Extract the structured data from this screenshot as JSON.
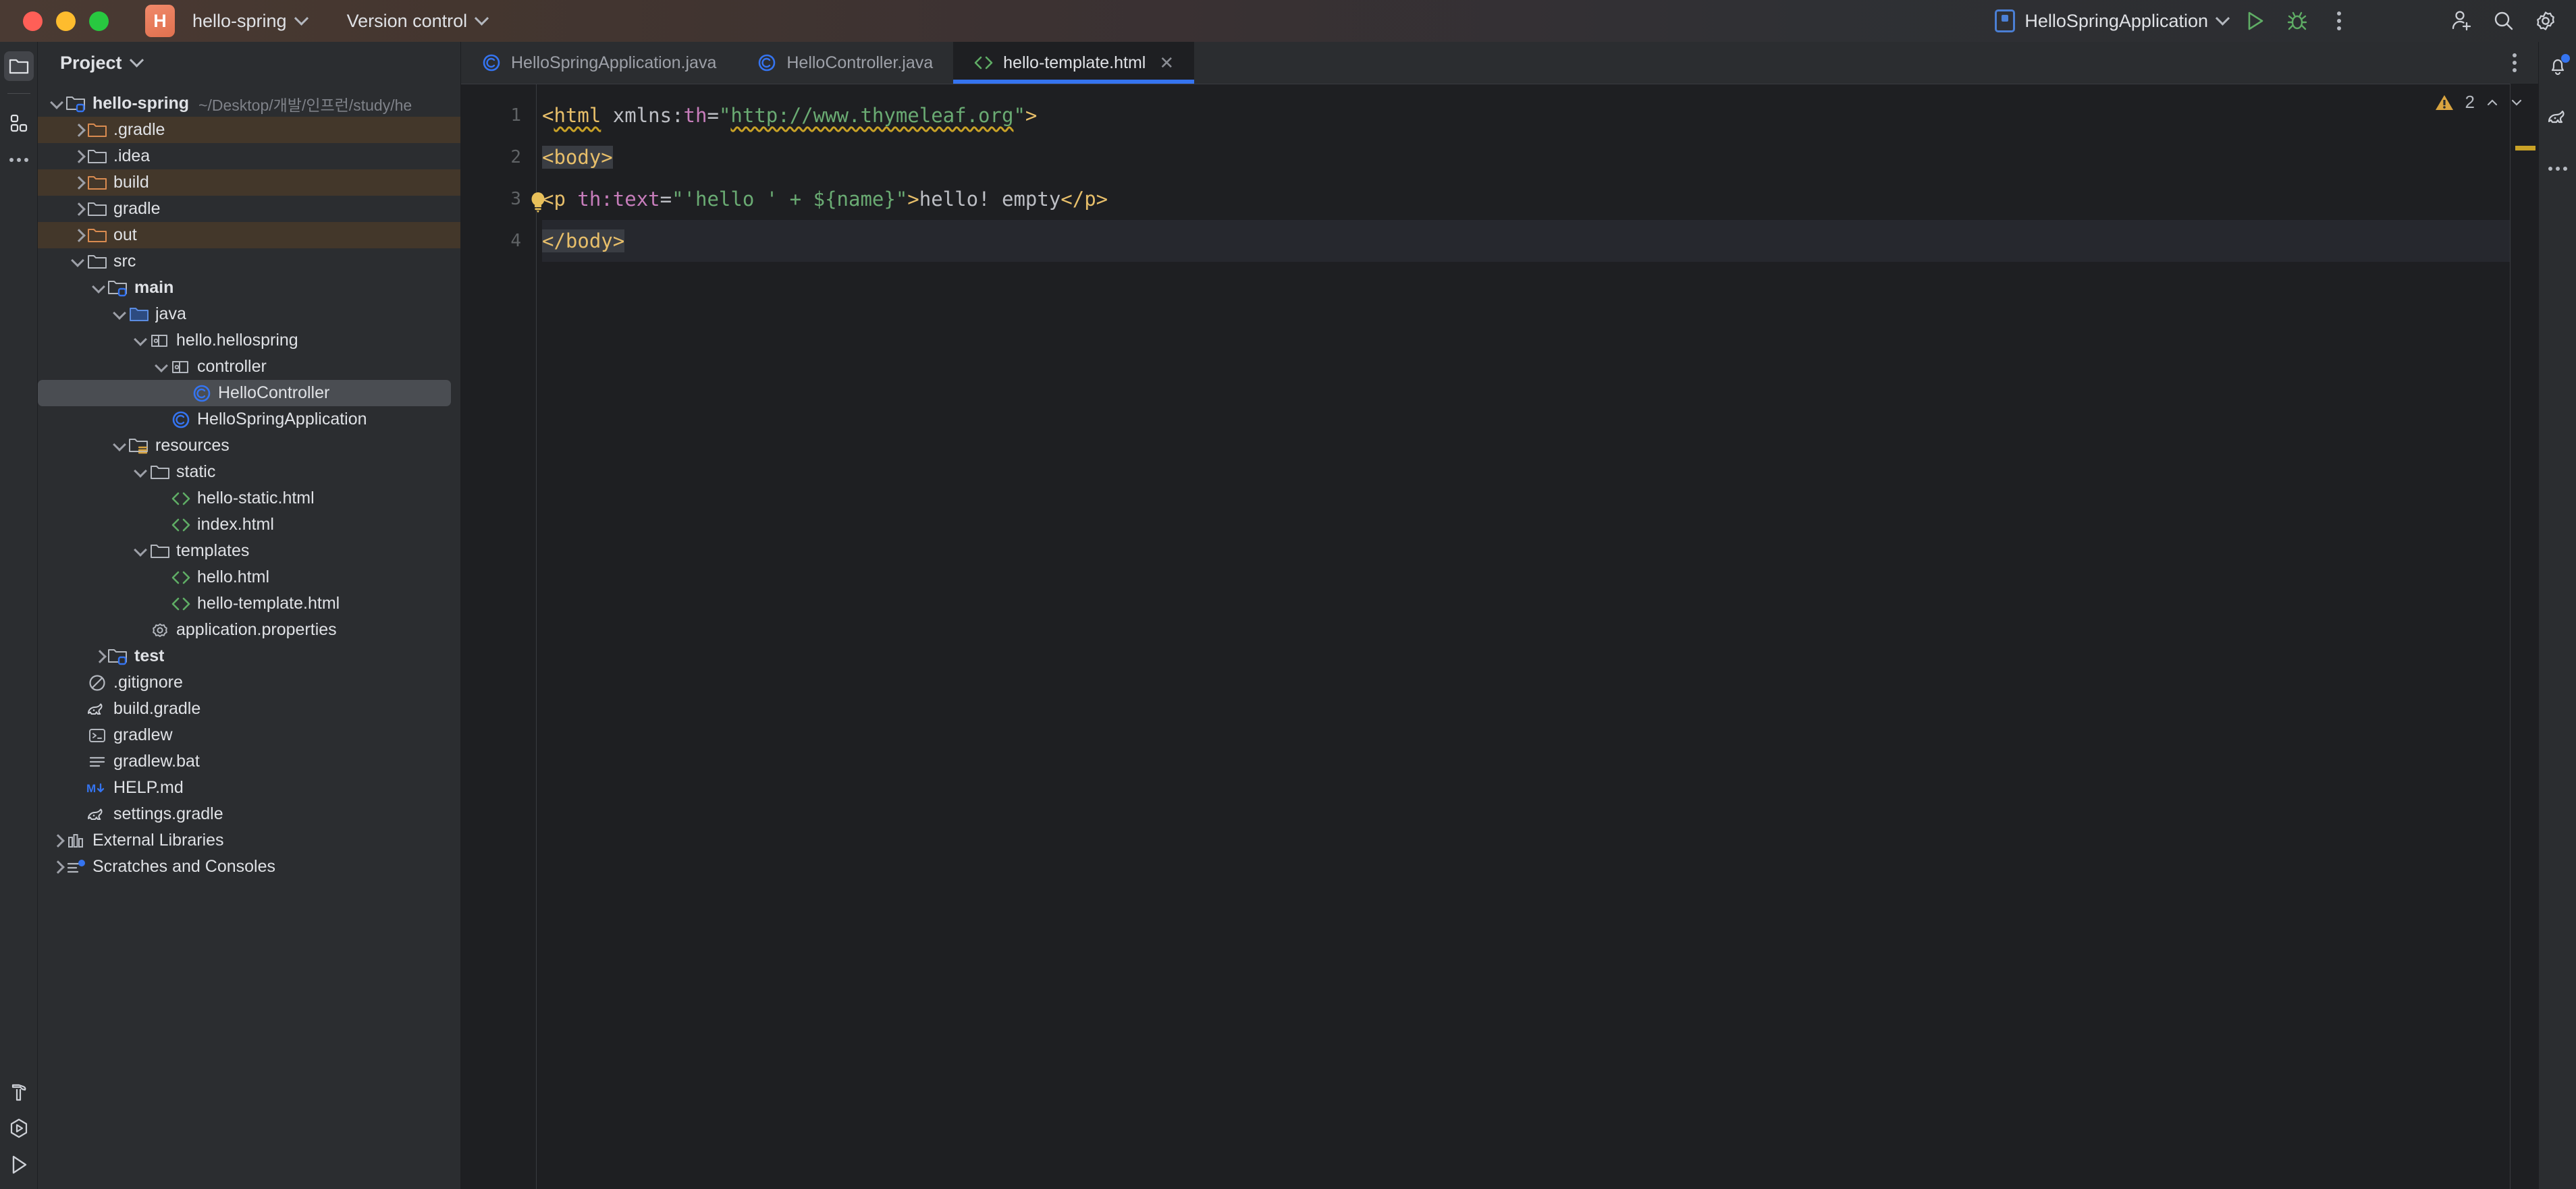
{
  "titlebar": {
    "project_badge": "H",
    "project_name": "hello-spring",
    "version_control": "Version control",
    "run_config": "HelloSpringApplication",
    "icons": {
      "run": "run-icon",
      "debug": "debug-icon",
      "more": "more-vertical-icon",
      "add_user": "add-user-icon",
      "search": "search-icon",
      "settings": "gear-icon"
    }
  },
  "left_rail": {
    "items": [
      {
        "name": "project-tool-window-icon",
        "active": true
      },
      {
        "name": "commit-tool-window-icon",
        "active": false
      },
      {
        "name": "more-tool-windows-icon",
        "active": false
      }
    ],
    "bottom_items": [
      {
        "name": "build-hammer-icon"
      },
      {
        "name": "services-icon"
      },
      {
        "name": "run-icon"
      }
    ]
  },
  "right_rail": {
    "items": [
      {
        "name": "notifications-bell-icon",
        "badge": true
      },
      {
        "name": "gradle-elephant-icon",
        "badge": false
      },
      {
        "name": "more-tool-windows-icon",
        "badge": false
      }
    ]
  },
  "project_panel": {
    "title": "Project",
    "tree": [
      {
        "depth": 0,
        "arrow": "open",
        "icon": "module-folder-icon",
        "label": "hello-spring",
        "bold": true,
        "path": "~/Desktop/개발/인프런/study/he",
        "state": "normal"
      },
      {
        "depth": 1,
        "arrow": "closed",
        "icon": "excluded-folder-icon",
        "label": ".gradle",
        "state": "excluded"
      },
      {
        "depth": 1,
        "arrow": "closed",
        "icon": "folder-icon",
        "label": ".idea",
        "state": "normal"
      },
      {
        "depth": 1,
        "arrow": "closed",
        "icon": "excluded-folder-icon",
        "label": "build",
        "state": "excluded"
      },
      {
        "depth": 1,
        "arrow": "closed",
        "icon": "folder-icon",
        "label": "gradle",
        "state": "normal"
      },
      {
        "depth": 1,
        "arrow": "closed",
        "icon": "excluded-folder-icon",
        "label": "out",
        "state": "excluded"
      },
      {
        "depth": 1,
        "arrow": "open",
        "icon": "folder-icon",
        "label": "src",
        "state": "normal"
      },
      {
        "depth": 2,
        "arrow": "open",
        "icon": "module-folder-icon",
        "label": "main",
        "bold": true,
        "state": "normal"
      },
      {
        "depth": 3,
        "arrow": "open",
        "icon": "source-folder-icon",
        "label": "java",
        "state": "normal"
      },
      {
        "depth": 4,
        "arrow": "open",
        "icon": "package-icon",
        "label": "hello.hellospring",
        "state": "normal"
      },
      {
        "depth": 5,
        "arrow": "open",
        "icon": "package-icon",
        "label": "controller",
        "state": "normal"
      },
      {
        "depth": 6,
        "arrow": "none",
        "icon": "java-class-icon",
        "label": "HelloController",
        "state": "selected"
      },
      {
        "depth": 5,
        "arrow": "none",
        "icon": "java-class-icon",
        "label": "HelloSpringApplication",
        "state": "normal"
      },
      {
        "depth": 3,
        "arrow": "open",
        "icon": "resources-folder-icon",
        "label": "resources",
        "state": "normal"
      },
      {
        "depth": 4,
        "arrow": "open",
        "icon": "folder-icon",
        "label": "static",
        "state": "normal"
      },
      {
        "depth": 5,
        "arrow": "none",
        "icon": "html-file-icon",
        "label": "hello-static.html",
        "state": "normal"
      },
      {
        "depth": 5,
        "arrow": "none",
        "icon": "html-file-icon",
        "label": "index.html",
        "state": "normal"
      },
      {
        "depth": 4,
        "arrow": "open",
        "icon": "folder-icon",
        "label": "templates",
        "state": "normal"
      },
      {
        "depth": 5,
        "arrow": "none",
        "icon": "html-file-icon",
        "label": "hello.html",
        "state": "normal"
      },
      {
        "depth": 5,
        "arrow": "none",
        "icon": "html-file-icon",
        "label": "hello-template.html",
        "state": "normal"
      },
      {
        "depth": 4,
        "arrow": "none",
        "icon": "properties-file-icon",
        "label": "application.properties",
        "state": "normal"
      },
      {
        "depth": 2,
        "arrow": "closed",
        "icon": "module-folder-icon",
        "label": "test",
        "bold": true,
        "state": "normal"
      },
      {
        "depth": 1,
        "arrow": "none",
        "icon": "gitignore-file-icon",
        "label": ".gitignore",
        "state": "normal"
      },
      {
        "depth": 1,
        "arrow": "none",
        "icon": "gradle-file-icon",
        "label": "build.gradle",
        "state": "normal"
      },
      {
        "depth": 1,
        "arrow": "none",
        "icon": "shell-script-icon",
        "label": "gradlew",
        "state": "normal"
      },
      {
        "depth": 1,
        "arrow": "none",
        "icon": "text-file-icon",
        "label": "gradlew.bat",
        "state": "normal"
      },
      {
        "depth": 1,
        "arrow": "none",
        "icon": "markdown-file-icon",
        "label": "HELP.md",
        "state": "normal"
      },
      {
        "depth": 1,
        "arrow": "none",
        "icon": "gradle-file-icon",
        "label": "settings.gradle",
        "state": "normal"
      },
      {
        "depth": 0,
        "arrow": "closed",
        "icon": "external-libraries-icon",
        "label": "External Libraries",
        "state": "normal"
      },
      {
        "depth": 0,
        "arrow": "closed",
        "icon": "scratches-icon",
        "label": "Scratches and Consoles",
        "state": "normal"
      }
    ]
  },
  "editor": {
    "tabs": [
      {
        "label": "HelloSpringApplication.java",
        "icon": "java-class-icon",
        "active": false,
        "closable": false
      },
      {
        "label": "HelloController.java",
        "icon": "java-class-icon",
        "active": false,
        "closable": false
      },
      {
        "label": "hello-template.html",
        "icon": "html-file-icon",
        "active": true,
        "closable": true
      }
    ],
    "tab_close_glyph": "✕",
    "more_tabs_icon": "more-vertical-icon",
    "line_numbers": [
      "1",
      "2",
      "3",
      "4"
    ],
    "caret_line": 4,
    "inspection": {
      "warning_icon": "warning-triangle-icon",
      "warning_count": "2",
      "prev_icon": "chevron-up-icon",
      "next_icon": "chevron-down-icon"
    },
    "gutter_intention_icon": "lightbulb-icon",
    "code_lines": [
      {
        "n": 1,
        "tokens": [
          {
            "t": "<",
            "c": "tag"
          },
          {
            "t": "html",
            "c": "tag squig"
          },
          {
            "t": " ",
            "c": "txt"
          },
          {
            "t": "xmlns:",
            "c": "attr"
          },
          {
            "t": "th",
            "c": "ns"
          },
          {
            "t": "=",
            "c": "attr"
          },
          {
            "t": "\"",
            "c": "str"
          },
          {
            "t": "http://www.thymeleaf.org",
            "c": "str squig"
          },
          {
            "t": "\"",
            "c": "str"
          },
          {
            "t": ">",
            "c": "tag"
          }
        ]
      },
      {
        "n": 2,
        "tokens": [
          {
            "t": "<body>",
            "c": "tag hl"
          }
        ]
      },
      {
        "n": 3,
        "tokens": [
          {
            "t": "<p",
            "c": "tag"
          },
          {
            "t": " ",
            "c": "txt"
          },
          {
            "t": "th:text",
            "c": "ns"
          },
          {
            "t": "=",
            "c": "attr"
          },
          {
            "t": "\"'hello '",
            "c": "str"
          },
          {
            "t": " + ",
            "c": "str"
          },
          {
            "t": "${name}",
            "c": "str"
          },
          {
            "t": "\"",
            "c": "str"
          },
          {
            "t": ">",
            "c": "tag"
          },
          {
            "t": "hello! empty",
            "c": "txt"
          },
          {
            "t": "</p>",
            "c": "tag"
          }
        ]
      },
      {
        "n": 4,
        "tokens": [
          {
            "t": "</body>",
            "c": "tag hl"
          }
        ]
      }
    ]
  }
}
